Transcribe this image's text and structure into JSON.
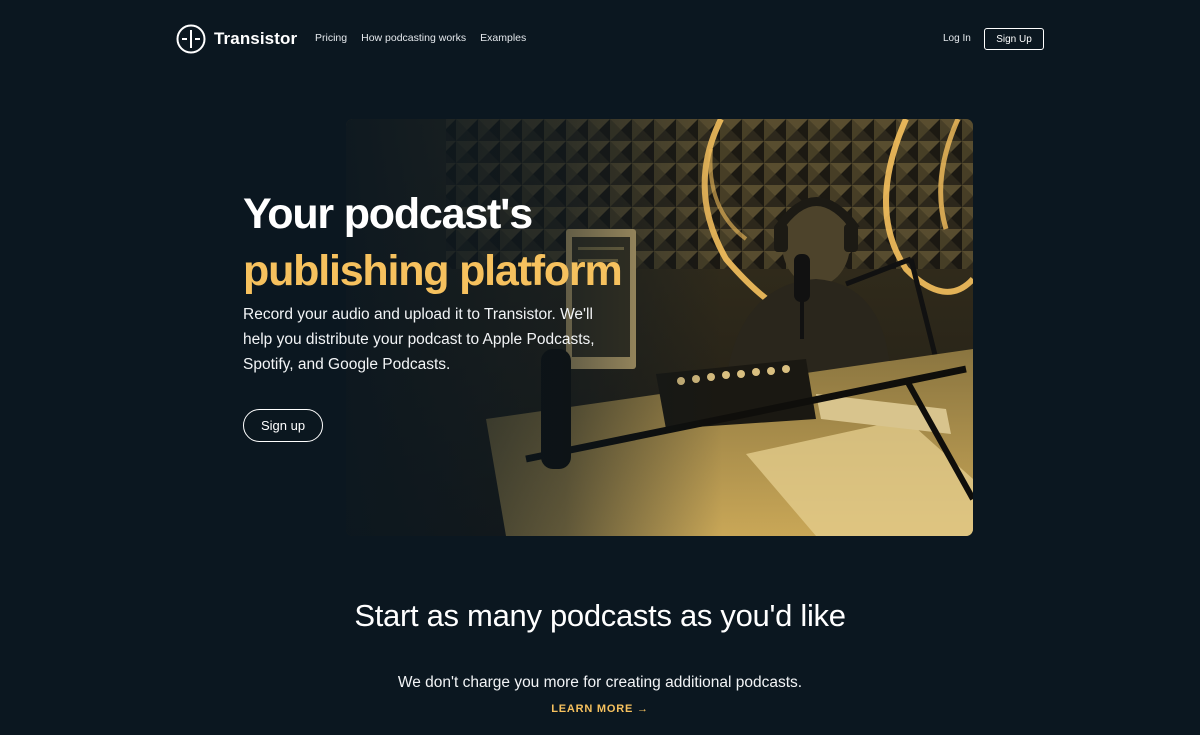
{
  "nav": {
    "brand": "Transistor",
    "links": [
      {
        "label": "Pricing"
      },
      {
        "label": "How podcasting works"
      },
      {
        "label": "Examples"
      }
    ],
    "login": "Log In",
    "signup": "Sign Up"
  },
  "hero": {
    "title_line1": "Your podcast's",
    "title_line2": "publishing platform",
    "subtitle": "Record your audio and upload it to Transistor. We'll help you distribute your podcast to Apple Podcasts, Spotify, and Google Podcasts.",
    "cta": "Sign up",
    "image_icon": "podcast-studio-photo"
  },
  "feature": {
    "title": "Start as many podcasts as you'd like",
    "subtitle": "We don't charge you more for creating additional podcasts.",
    "link": "LEARN MORE →"
  },
  "colors": {
    "background": "#0b1720",
    "accent": "#f6c15e",
    "text": "#ffffff"
  }
}
